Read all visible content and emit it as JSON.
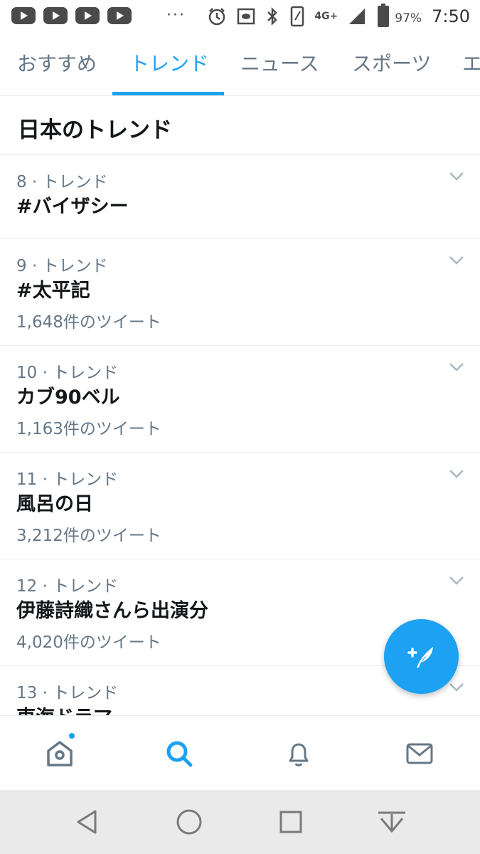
{
  "status_bar": {
    "network": "4G+",
    "battery": "97%",
    "time": "7:50",
    "overflow": "···",
    "icons": [
      "youtube-icon",
      "youtube-icon",
      "youtube-icon",
      "youtube-icon",
      "alarm-icon",
      "app-notification-icon",
      "bluetooth-icon",
      "vibrate-icon",
      "signal-icon",
      "battery-icon"
    ]
  },
  "tabs": [
    {
      "label": "おすすめ",
      "active": false
    },
    {
      "label": "トレンド",
      "active": true
    },
    {
      "label": "ニュース",
      "active": false
    },
    {
      "label": "スポーツ",
      "active": false
    },
    {
      "label": "エ",
      "active": false
    }
  ],
  "section": {
    "title": "日本のトレンド"
  },
  "trends": [
    {
      "meta": "8 · トレンド",
      "name": "#バイザシー",
      "count": ""
    },
    {
      "meta": "9 · トレンド",
      "name": "#太平記",
      "count": "1,648件のツイート"
    },
    {
      "meta": "10 · トレンド",
      "name": "カブ90ベル",
      "count": "1,163件のツイート"
    },
    {
      "meta": "11 · トレンド",
      "name": "風呂の日",
      "count": "3,212件のツイート"
    },
    {
      "meta": "12 · トレンド",
      "name": "伊藤詩織さんら出演分",
      "count": "4,020件のツイート"
    },
    {
      "meta": "13 · トレンド",
      "name": "東海ドラマ",
      "count": ""
    }
  ],
  "fab": {
    "icon": "compose-tweet-icon"
  },
  "bottom_nav": [
    "home-icon",
    "search-icon",
    "notifications-icon",
    "messages-icon"
  ],
  "colors": {
    "accent": "#1da1f2",
    "text": "#14171a",
    "secondary": "#657786",
    "divider": "#e6ecf0"
  }
}
